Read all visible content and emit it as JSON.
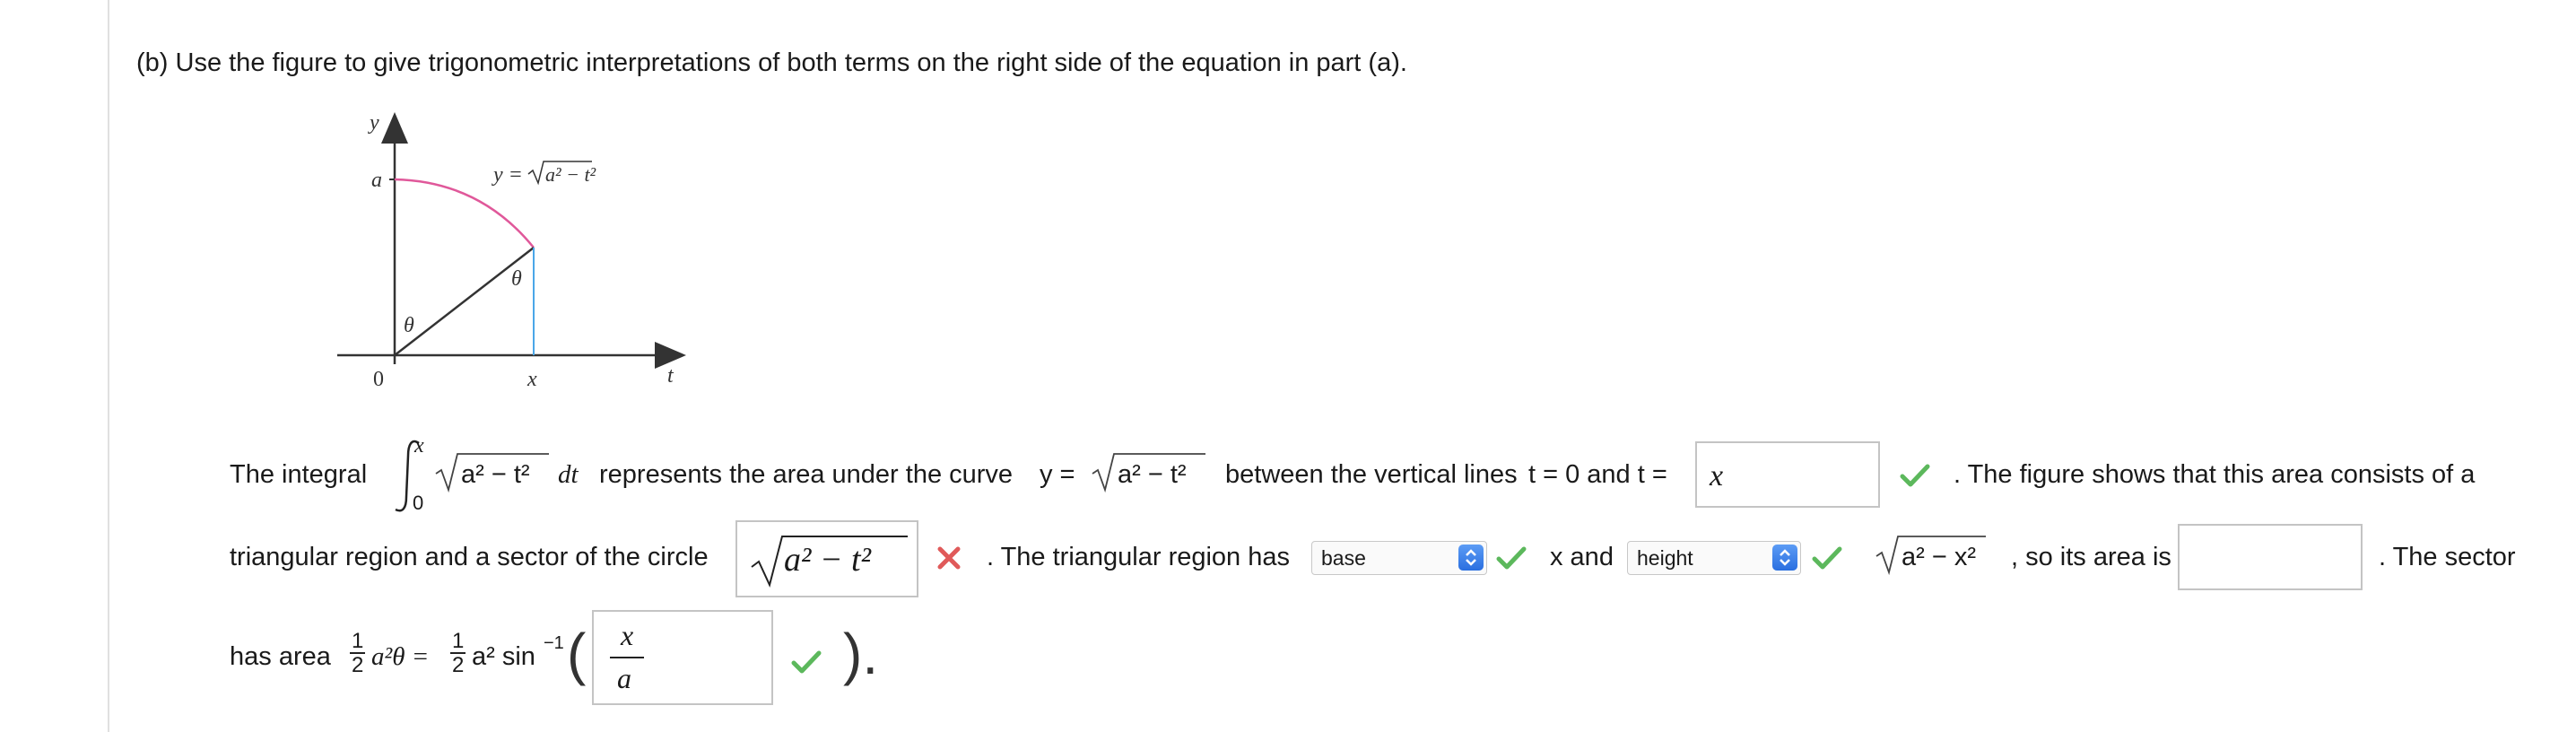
{
  "prompt_b": "(b) Use the figure to give trigonometric interpretations of both terms on the right side of the equation in part (a).",
  "figure": {
    "y_axis": "y",
    "t_axis": "t",
    "a_label": "a",
    "origin": "0",
    "x_label": "x",
    "theta_origin": "θ",
    "theta_point": "θ",
    "curve_label_left": "y = ",
    "curve_label_rad": "a² − t²",
    "curve_color": "#e0589a",
    "vline_color": "#4aa6e8"
  },
  "line1": {
    "text1": "The integral",
    "int_upper": "x",
    "int_lower": "0",
    "integrand": "a² − t²",
    "dt": "dt",
    "text2": "represents the area under the curve",
    "y_eq": "y =",
    "curve_rad": "a² − t²",
    "text3": "between the vertical lines",
    "t0": "t = 0 and t =",
    "answer1": "x",
    "text4": ". The figure shows that this area consists of a"
  },
  "line2": {
    "text1": "triangular region and a sector of the circle",
    "answer2": "a² − t²",
    "text2": ". The triangular region has",
    "select1": "base",
    "mid": "x and",
    "select2": "height",
    "rad3": "a² − x²",
    "text3": ", so its area is",
    "answer3": "",
    "text4": ". The sector"
  },
  "line3": {
    "text1": "has area",
    "frac_num": "1",
    "frac_den": "2",
    "a2theta": "a²θ =",
    "a2sin": "a² sin",
    "inv": "−1",
    "paren_open": "(",
    "answer4_num": "x",
    "answer4_den": "a",
    "paren_close": ")."
  },
  "status": {
    "correct_color": "#5cb85c",
    "wrong_color": "#e05a5a"
  }
}
